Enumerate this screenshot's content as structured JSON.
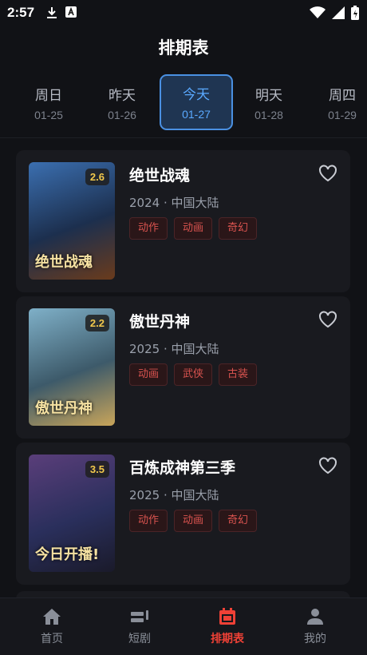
{
  "status_bar": {
    "time": "2:57"
  },
  "header": {
    "title": "排期表"
  },
  "date_tabs": [
    {
      "weekday": "周日",
      "date": "01-25",
      "active": false
    },
    {
      "weekday": "昨天",
      "date": "01-26",
      "active": false
    },
    {
      "weekday": "今天",
      "date": "01-27",
      "active": true
    },
    {
      "weekday": "明天",
      "date": "01-28",
      "active": false
    },
    {
      "weekday": "周四",
      "date": "01-29",
      "active": false
    }
  ],
  "shows": [
    {
      "title": "绝世战魂",
      "rating": "2.6",
      "meta": "2024 · 中国大陆",
      "tags": [
        "动作",
        "动画",
        "奇幻"
      ],
      "poster_text": "绝世战魂",
      "poster_colors": [
        "#3b6fb0",
        "#1c2f4e",
        "#6a3b1c"
      ]
    },
    {
      "title": "傲世丹神",
      "rating": "2.2",
      "meta": "2025 · 中国大陆",
      "tags": [
        "动画",
        "武侠",
        "古装"
      ],
      "poster_text": "傲世丹神",
      "poster_colors": [
        "#7fb0c8",
        "#3d5a6a",
        "#c9a55a"
      ]
    },
    {
      "title": "百炼成神第三季",
      "rating": "3.5",
      "meta": "2025 · 中国大陆",
      "tags": [
        "动作",
        "动画",
        "奇幻"
      ],
      "poster_text": "今日开播!",
      "poster_colors": [
        "#5a3e7a",
        "#2a2f5c",
        "#1a1a2a"
      ]
    }
  ],
  "bottom_nav": [
    {
      "label": "首页",
      "icon": "home-icon",
      "active": false
    },
    {
      "label": "短剧",
      "icon": "short-drama-icon",
      "active": false
    },
    {
      "label": "排期表",
      "icon": "calendar-icon",
      "active": true
    },
    {
      "label": "我的",
      "icon": "person-icon",
      "active": false
    }
  ],
  "colors": {
    "accent_blue": "#4a90e2",
    "accent_red": "#ef4136",
    "rating": "#f2c94c"
  }
}
